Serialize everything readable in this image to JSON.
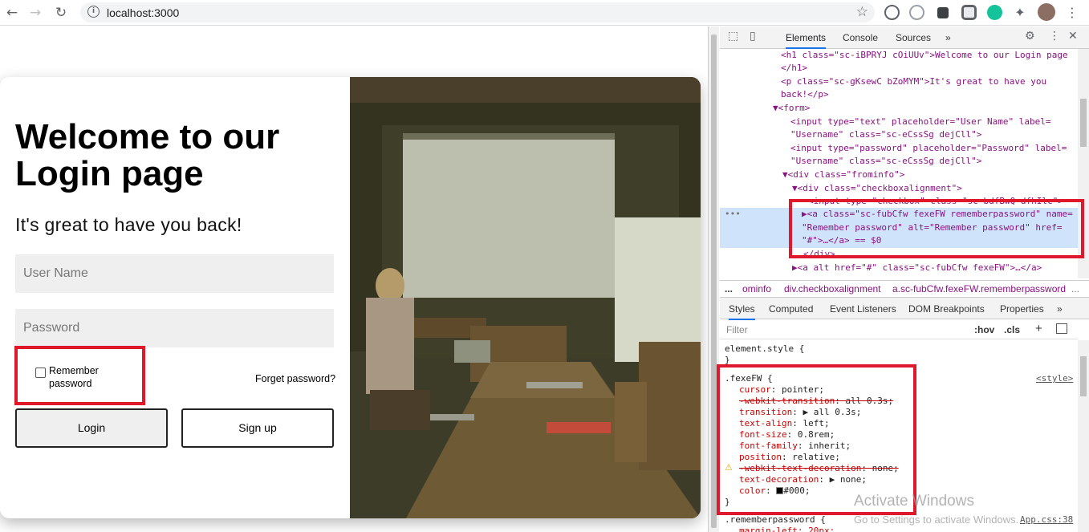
{
  "browser": {
    "url": "localhost:3000",
    "back_icon": "arrow-left-icon",
    "forward_icon": "arrow-right-icon",
    "reload_icon": "reload-icon",
    "info_icon": "info-icon",
    "star_icon": "star-icon",
    "menu_icon": "kebab-menu-icon"
  },
  "login": {
    "title": "Welcome to our Login page",
    "subtitle": "It's great to have you back!",
    "username_placeholder": "User Name",
    "password_placeholder": "Password",
    "remember_label": "Remember password",
    "forget_label": "Forget password?",
    "login_label": "Login",
    "signup_label": "Sign up"
  },
  "devtools": {
    "tabs": [
      "Elements",
      "Console",
      "Sources",
      "»"
    ],
    "elements_lines": {
      "l1": "<h1 class=\"sc-iBPRYJ cOiUUv\">Welcome to our Login page",
      "l2": "</h1>",
      "l3": "<p class=\"sc-gKsewC bZoMYM\">It's great to have you",
      "l4": "back!</p>",
      "l5": "▼<form>",
      "l6": "<input type=\"text\" placeholder=\"User Name\" label=",
      "l7": "\"Username\" class=\"sc-eCssSg dejCll\">",
      "l8": "<input type=\"password\" placeholder=\"Password\" label=",
      "l9": "\"Username\" class=\"sc-eCssSg dejCll\">",
      "l10": "▼<div class=\"frominfo\">",
      "l11": "▼<div class=\"checkboxalignment\">",
      "l12": "<input type=\"checkbox\" class=\"sc-bdfBwQ dfhIlc\">",
      "l13": "▶<a class=\"sc-fubCfw fexeFW rememberpassword\" name=",
      "l14": "\"Remember password\" alt=\"Remember password\" href=",
      "l15": "\"#\">…</a> == $0",
      "l16": "</div>",
      "l17": "▶<a alt href=\"#\" class=\"sc-fubCfw fexeFW\">…</a>",
      "dots": "•••"
    },
    "breadcrumbs": [
      "...",
      "ominfo",
      "div.checkboxalignment",
      "a.sc-fubCfw.fexeFW.rememberpassword",
      "..."
    ],
    "style_tabs": [
      "Styles",
      "Computed",
      "Event Listeners",
      "DOM Breakpoints",
      "Properties",
      "»"
    ],
    "filter_placeholder": "Filter",
    "filter_hov": ":hov",
    "filter_cls": ".cls",
    "filter_plus": "+",
    "styles": {
      "element_style": "element.style {",
      "element_close": "}",
      "selector": ".fexeFW {",
      "source": "<style>",
      "p1_name": "cursor",
      "p1_val": "pointer;",
      "p2_name": "-webkit-transition",
      "p2_val": "all 0.3s;",
      "p3_name": "transition",
      "p3_val": "▶ all 0.3s;",
      "p4_name": "text-align",
      "p4_val": "left;",
      "p5_name": "font-size",
      "p5_val": "0.8rem;",
      "p6_name": "font-family",
      "p6_val": "inherit;",
      "p7_name": "position",
      "p7_val": "relative;",
      "p8_name": "-webkit-text-decoration",
      "p8_val": "none;",
      "p9_name": "text-decoration",
      "p9_val": "▶ none;",
      "p10_name": "color",
      "p10_val": "#000;",
      "close": "}",
      "next_selector": ".rememberpassword {",
      "next_source": "App.css:38",
      "next_prop": "margin-left: 20px;"
    }
  },
  "watermark": {
    "line1": "Activate Windows",
    "line2": "Go to Settings to activate Windows."
  },
  "colors": {
    "highlight": "#e0182c",
    "selection": "#cfe3fb",
    "accent": "#1a73e8"
  }
}
